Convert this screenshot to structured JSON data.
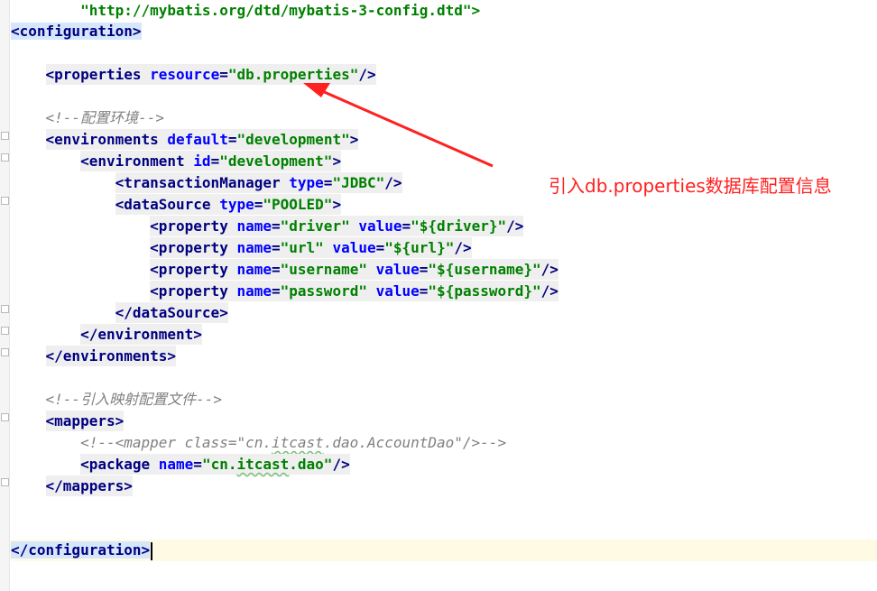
{
  "editor": {
    "doctype_url": "\"http://mybatis.org/dtd/mybatis-3-config.dtd\">",
    "lines": {
      "config_open": "<configuration>",
      "props_open": "<properties",
      "props_attr": "resource",
      "props_val": "\"db.properties\"",
      "props_close": "/>",
      "cmt_env": "<!--配置环境-->",
      "envs_open": "<environments",
      "envs_attr": "default",
      "envs_val": "\"development\"",
      "envs_close": ">",
      "env_open": "<environment",
      "env_attr": "id",
      "env_val": "\"development\"",
      "env_close": ">",
      "tm_open": "<transactionManager",
      "tm_attr": "type",
      "tm_val": "\"JDBC\"",
      "tm_close": "/>",
      "ds_open": "<dataSource",
      "ds_attr": "type",
      "ds_val": "\"POOLED\"",
      "ds_close": ">",
      "p_open": "<property",
      "p_name": "name",
      "p_value": "value",
      "p_close": "/>",
      "p1_n": "\"driver\"",
      "p1_v": "\"${driver}\"",
      "p2_n": "\"url\"",
      "p2_v": "\"${url}\"",
      "p3_n": "\"username\"",
      "p3_v": "\"${username}\"",
      "p4_n": "\"password\"",
      "p4_v": "\"${password}\"",
      "ds_end": "</dataSource>",
      "env_end": "</environment>",
      "envs_end": "</environments>",
      "cmt_map": "<!--引入映射配置文件-->",
      "mappers_open": "<mappers>",
      "cmt_mapper_a": "<!--<mapper class=\"cn.",
      "cmt_mapper_b": "itcast",
      "cmt_mapper_c": ".dao.AccountDao\"/>-->",
      "pkg_open": "<package",
      "pkg_attr": "name",
      "pkg_val_a": "\"cn.",
      "pkg_val_b": "itcast",
      "pkg_val_c": ".dao\"",
      "pkg_close": "/>",
      "mappers_end": "</mappers>",
      "config_end": "</configuration>"
    }
  },
  "annotation": {
    "text": "引入db.properties数据库配置信息",
    "color": "#ff2020"
  },
  "colors": {
    "tag": "#000080",
    "attribute": "#0000ff",
    "value": "#008000",
    "comment": "#808080",
    "selection": "#d6e6fb",
    "current_line": "#fffae3"
  }
}
